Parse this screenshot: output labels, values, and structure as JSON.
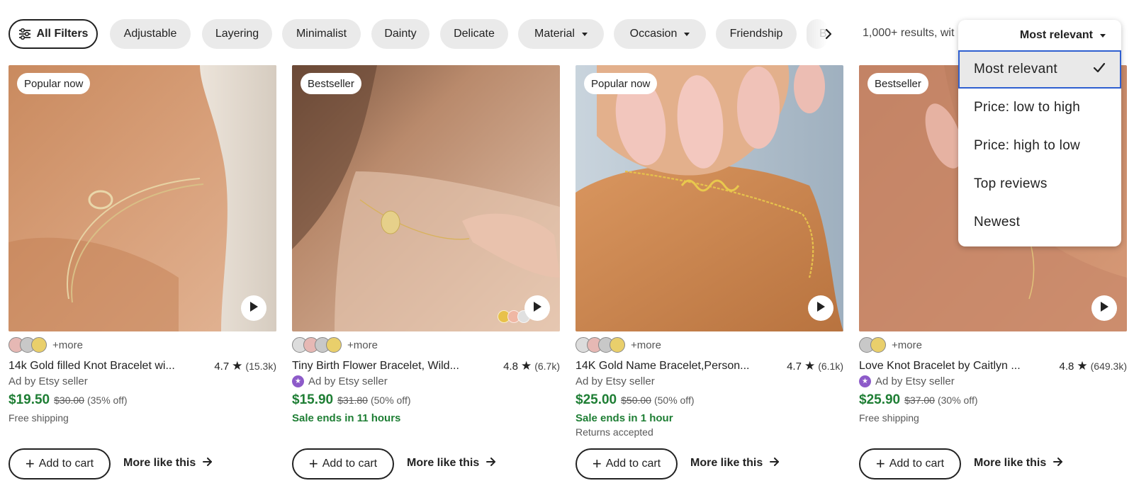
{
  "filters": {
    "all_filters_label": "All Filters",
    "chips": [
      {
        "label": "Adjustable"
      },
      {
        "label": "Layering"
      },
      {
        "label": "Minimalist"
      },
      {
        "label": "Dainty"
      },
      {
        "label": "Delicate"
      },
      {
        "label": "Material"
      },
      {
        "label": "Occasion"
      },
      {
        "label": "Friendship"
      },
      {
        "label": "B"
      }
    ],
    "results_text": "1,000+ results, wit"
  },
  "sort": {
    "current": "Most relevant",
    "options": [
      {
        "label": "Most relevant",
        "selected": true
      },
      {
        "label": "Price: low to high"
      },
      {
        "label": "Price: high to low"
      },
      {
        "label": "Top reviews"
      },
      {
        "label": "Newest"
      }
    ]
  },
  "products": [
    {
      "badge": "Popular now",
      "more": "+more",
      "title": "14k Gold filled Knot Bracelet wi...",
      "rating": "4.7",
      "reviews": "(15.3k)",
      "seller": "Ad by Etsy seller",
      "price": "$19.50",
      "original_price": "$30.00",
      "discount": "(35% off)",
      "line1": "Free shipping",
      "line2": "",
      "add_to_cart": "Add to cart",
      "more_like": "More like this",
      "swatch_colors": [
        "#e6b8b4",
        "#c8c8c8",
        "#e9cf6b"
      ],
      "star_seller": false
    },
    {
      "badge": "Bestseller",
      "more": "+more",
      "title": "Tiny Birth Flower Bracelet, Wild...",
      "rating": "4.8",
      "reviews": "(6.7k)",
      "seller": "Ad by Etsy seller",
      "price": "$15.90",
      "original_price": "$31.80",
      "discount": "(50% off)",
      "line1": "Sale ends in 11 hours",
      "line2": "",
      "add_to_cart": "Add to cart",
      "more_like": "More like this",
      "swatch_colors": [
        "#dcdcdc",
        "#e6b8b4",
        "#c8c8c8",
        "#e9cf6b"
      ],
      "star_seller": true
    },
    {
      "badge": "Popular now",
      "more": "+more",
      "title": "14K Gold Name Bracelet,Person...",
      "rating": "4.7",
      "reviews": "(6.1k)",
      "seller": "Ad by Etsy seller",
      "price": "$25.00",
      "original_price": "$50.00",
      "discount": "(50% off)",
      "line1": "Sale ends in 1 hour",
      "line2": "Returns accepted",
      "add_to_cart": "Add to cart",
      "more_like": "More like this",
      "swatch_colors": [
        "#dcdcdc",
        "#e6b8b4",
        "#c8c8c8",
        "#e9cf6b"
      ],
      "star_seller": false
    },
    {
      "badge": "Bestseller",
      "more": "+more",
      "title": "Love Knot Bracelet by Caitlyn ...",
      "rating": "4.8",
      "reviews": "(649.3k)",
      "seller": "Ad by Etsy seller",
      "price": "$25.90",
      "original_price": "$37.00",
      "discount": "(30% off)",
      "line1": "Free shipping",
      "line2": "",
      "add_to_cart": "Add to cart",
      "more_like": "More like this",
      "swatch_colors": [
        "#c8c8c8",
        "#e9cf6b"
      ],
      "star_seller": true
    }
  ],
  "colors": {
    "price_green": "#1e7e34",
    "star_seller_purple": "#8d5bc9",
    "focus_blue": "#2f5fd0"
  }
}
